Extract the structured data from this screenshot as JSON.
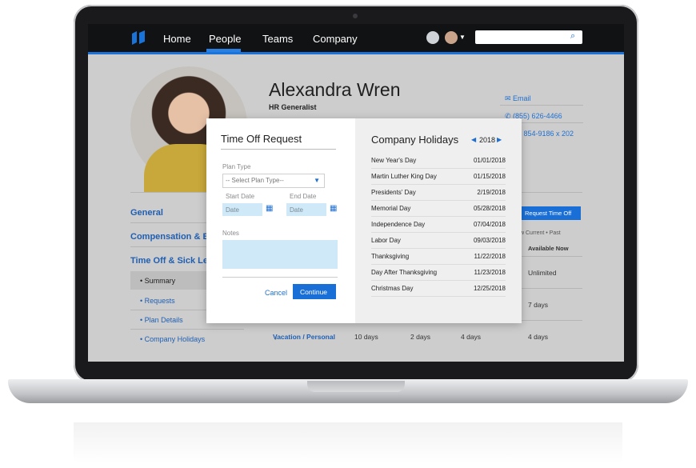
{
  "nav": {
    "items": [
      "Home",
      "People",
      "Teams",
      "Company"
    ],
    "active": "People",
    "search_placeholder": ""
  },
  "profile": {
    "name": "Alexandra Wren",
    "title": "HR Generalist",
    "email_label": "Email",
    "phone1": "(855) 626-4466",
    "phone2": "(855) 854-9186 x 202"
  },
  "sidebar": {
    "sections": [
      "General",
      "Compensation & Benefits",
      "Time Off & Sick Leave"
    ],
    "subitems": [
      "• Summary",
      "• Requests",
      "• Plan Details",
      "• Company Holidays"
    ]
  },
  "timeoff": {
    "request_button": "Request Time Off",
    "view_label": "w Current • Past",
    "available_header": "Available Now",
    "unlimited": "Unlimited",
    "seven_days": "7 days",
    "row_label": "Vacation / Personal",
    "row_values": [
      "10 days",
      "2 days",
      "4 days",
      "4 days"
    ]
  },
  "modal": {
    "title": "Time Off Request",
    "plan_type_label": "Plan Type",
    "plan_type_placeholder": "-- Select Plan Type--",
    "start_label": "Start Date",
    "end_label": "End Date",
    "date_placeholder": "Date",
    "notes_label": "Notes",
    "cancel": "Cancel",
    "continue": "Continue",
    "holidays_title": "Company Holidays",
    "year": "2018",
    "holidays": [
      {
        "name": "New Year's Day",
        "date": "01/01/2018"
      },
      {
        "name": "Martin Luther King Day",
        "date": "01/15/2018"
      },
      {
        "name": "Presidents' Day",
        "date": "2/19/2018"
      },
      {
        "name": "Memorial Day",
        "date": "05/28/2018"
      },
      {
        "name": "Independence Day",
        "date": "07/04/2018"
      },
      {
        "name": "Labor Day",
        "date": "09/03/2018"
      },
      {
        "name": "Thanksgiving",
        "date": "11/22/2018"
      },
      {
        "name": "Day After Thanksgiving",
        "date": "11/23/2018"
      },
      {
        "name": "Christmas Day",
        "date": "12/25/2018"
      }
    ]
  },
  "colors": {
    "accent": "#1a73d9",
    "nav_bg": "#111213",
    "field_bg": "#cfe9f8"
  }
}
